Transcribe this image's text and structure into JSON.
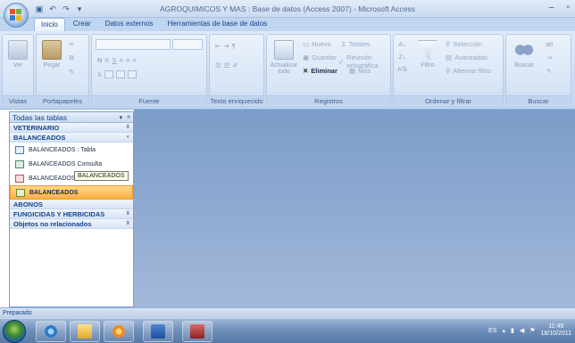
{
  "window": {
    "title": "AGROQUIMICOS Y MAS : Base de datos (Access 2007) - Microsoft Access",
    "controls": {
      "minimize": "–",
      "maximize": "▫"
    }
  },
  "tabs": [
    {
      "label": "Inicio",
      "active": true
    },
    {
      "label": "Crear",
      "active": false
    },
    {
      "label": "Datos externos",
      "active": false
    },
    {
      "label": "Herramientas de base de datos",
      "active": false
    }
  ],
  "ribbon": {
    "groups": {
      "vistas": "Vistas",
      "portapapeles": "Portapapeles",
      "fuente": "Fuente",
      "texto_enriquecido": "Texto enriquecido",
      "registros": "Registros",
      "ordenar": "Ordenar y filtrar",
      "buscar": "Buscar"
    },
    "buttons": {
      "ver": "Ver",
      "pegar": "Pegar",
      "actualizar": "Actualizar todo",
      "nuevo": "Nuevo",
      "totales": "Totales",
      "guardar": "Guardar",
      "revision": "Revisión ortográfica",
      "eliminar": "Eliminar",
      "mas": "Más",
      "filtro": "Filtro",
      "seleccion": "Selección",
      "avanzadas": "Avanzadas",
      "alternar": "Alternar filtro",
      "buscar": "Buscar"
    }
  },
  "nav": {
    "header": "Todas las tablas",
    "groups": [
      {
        "label": "VETERINARIO",
        "chevron": "¥"
      },
      {
        "label": "BALANCEADOS",
        "chevron": "«"
      }
    ],
    "items": [
      {
        "label": "BALANCEADOS : Tabla",
        "selected": false
      },
      {
        "label": "BALANCEADOS Consulta",
        "selected": false
      },
      {
        "label": "BALANCEADOS",
        "selected": false
      },
      {
        "label": "BALANCEADOS",
        "selected": true
      }
    ],
    "groups_after": [
      {
        "label": "ABONOS"
      },
      {
        "label": "FUNGICIDAS Y HERBICIDAS",
        "chevron": "¥"
      },
      {
        "label": "Objetos no relacionados",
        "chevron": "¥"
      }
    ],
    "tooltip": "BALANCEADOS"
  },
  "status": {
    "text": "Preparado"
  },
  "taskbar": {
    "tray": {
      "lang": "ES",
      "time": "11:49",
      "date": "18/10/2011"
    }
  },
  "colors": {
    "accent": "#15428b",
    "selected": "#ffb54c",
    "workspace": "#8ea9d1"
  }
}
